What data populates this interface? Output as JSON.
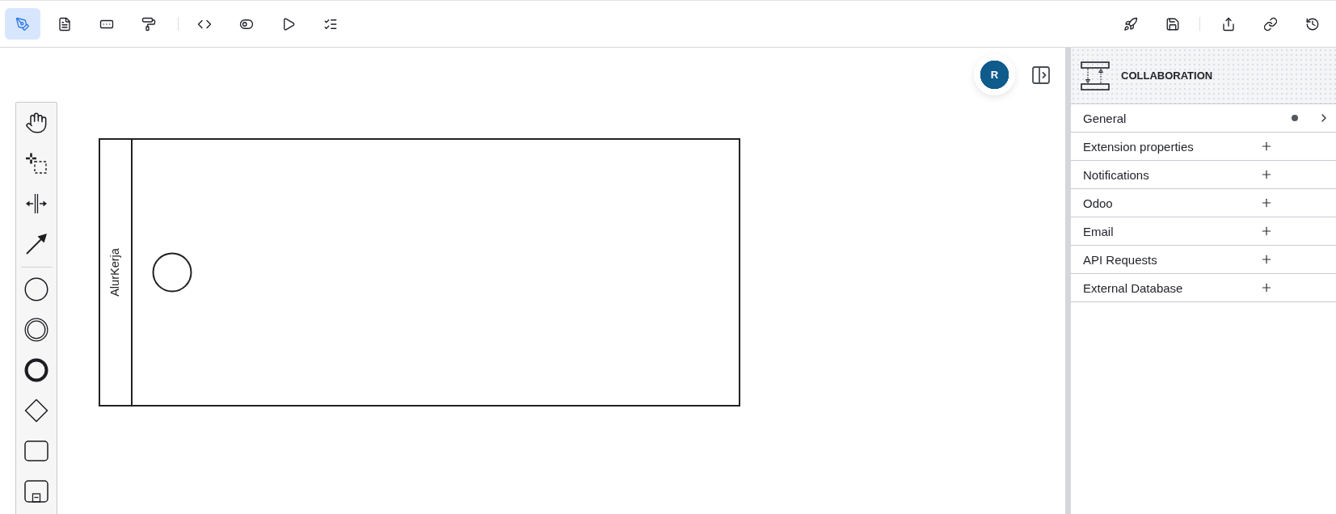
{
  "toolbar": {
    "mode_tabs": [
      {
        "kind": "pen",
        "selected": true
      },
      {
        "kind": "document",
        "selected": false
      },
      {
        "kind": "form",
        "selected": false
      },
      {
        "kind": "paint",
        "selected": false
      }
    ]
  },
  "canvas": {
    "avatar": {
      "initial": "R"
    },
    "pool": {
      "label": "AlurKerja"
    }
  },
  "properties_panel": {
    "title": "COLLABORATION",
    "groups": [
      {
        "label": "General",
        "kind": "section",
        "has_values": true,
        "expanded": false
      },
      {
        "label": "Extension properties",
        "kind": "list"
      },
      {
        "label": "Notifications",
        "kind": "list"
      },
      {
        "label": "Odoo",
        "kind": "list"
      },
      {
        "label": "Email",
        "kind": "list"
      },
      {
        "label": "API Requests",
        "kind": "list"
      },
      {
        "label": "External Database",
        "kind": "list"
      }
    ]
  }
}
